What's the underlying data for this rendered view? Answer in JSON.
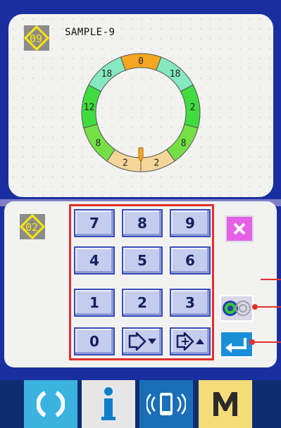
{
  "pattern": {
    "number": "09",
    "name": "SAMPLE-9",
    "gauge": {
      "outer_segments": [
        {
          "label": "0",
          "color": "#f5a623"
        },
        {
          "label": "18",
          "color": "#86e8c0"
        },
        {
          "label": "2",
          "color": "#3fdb3f"
        },
        {
          "label": "8",
          "color": "#74e044"
        },
        {
          "label": "2",
          "color": "#f5d59a"
        },
        {
          "label": "2",
          "color": "#f5d59a"
        },
        {
          "label": "8",
          "color": "#74e044"
        },
        {
          "label": "12",
          "color": "#3fdb3f"
        },
        {
          "label": "18",
          "color": "#86e8c0"
        }
      ]
    }
  },
  "input": {
    "number": "02"
  },
  "keypad": {
    "keys": [
      "7",
      "8",
      "9",
      "4",
      "5",
      "6",
      "1",
      "2",
      "3",
      "0"
    ]
  },
  "icons": {
    "close": "close-icon",
    "bobbin_winder": "bobbin-winder-icon",
    "enter": "enter-icon",
    "prev": "previous-data-icon",
    "next": "next-data-icon"
  },
  "colors": {
    "screen_frame": "#1a2f9f",
    "key_face": "#c5cdee",
    "highlight_red": "#e03030",
    "close_pink": "#e660e6",
    "enter_blue": "#1a8fd8",
    "bar_navy": "#0e2d70",
    "icon_yellow": "#ffe800"
  },
  "bottom_bar": {
    "items": [
      {
        "name": "ready-button",
        "icon": "ready-icon"
      },
      {
        "name": "information-button",
        "icon": "info-icon",
        "label": "i"
      },
      {
        "name": "communication-button",
        "icon": "communication-icon"
      },
      {
        "name": "mode-button",
        "icon": "mode-icon",
        "label": "M"
      }
    ]
  }
}
